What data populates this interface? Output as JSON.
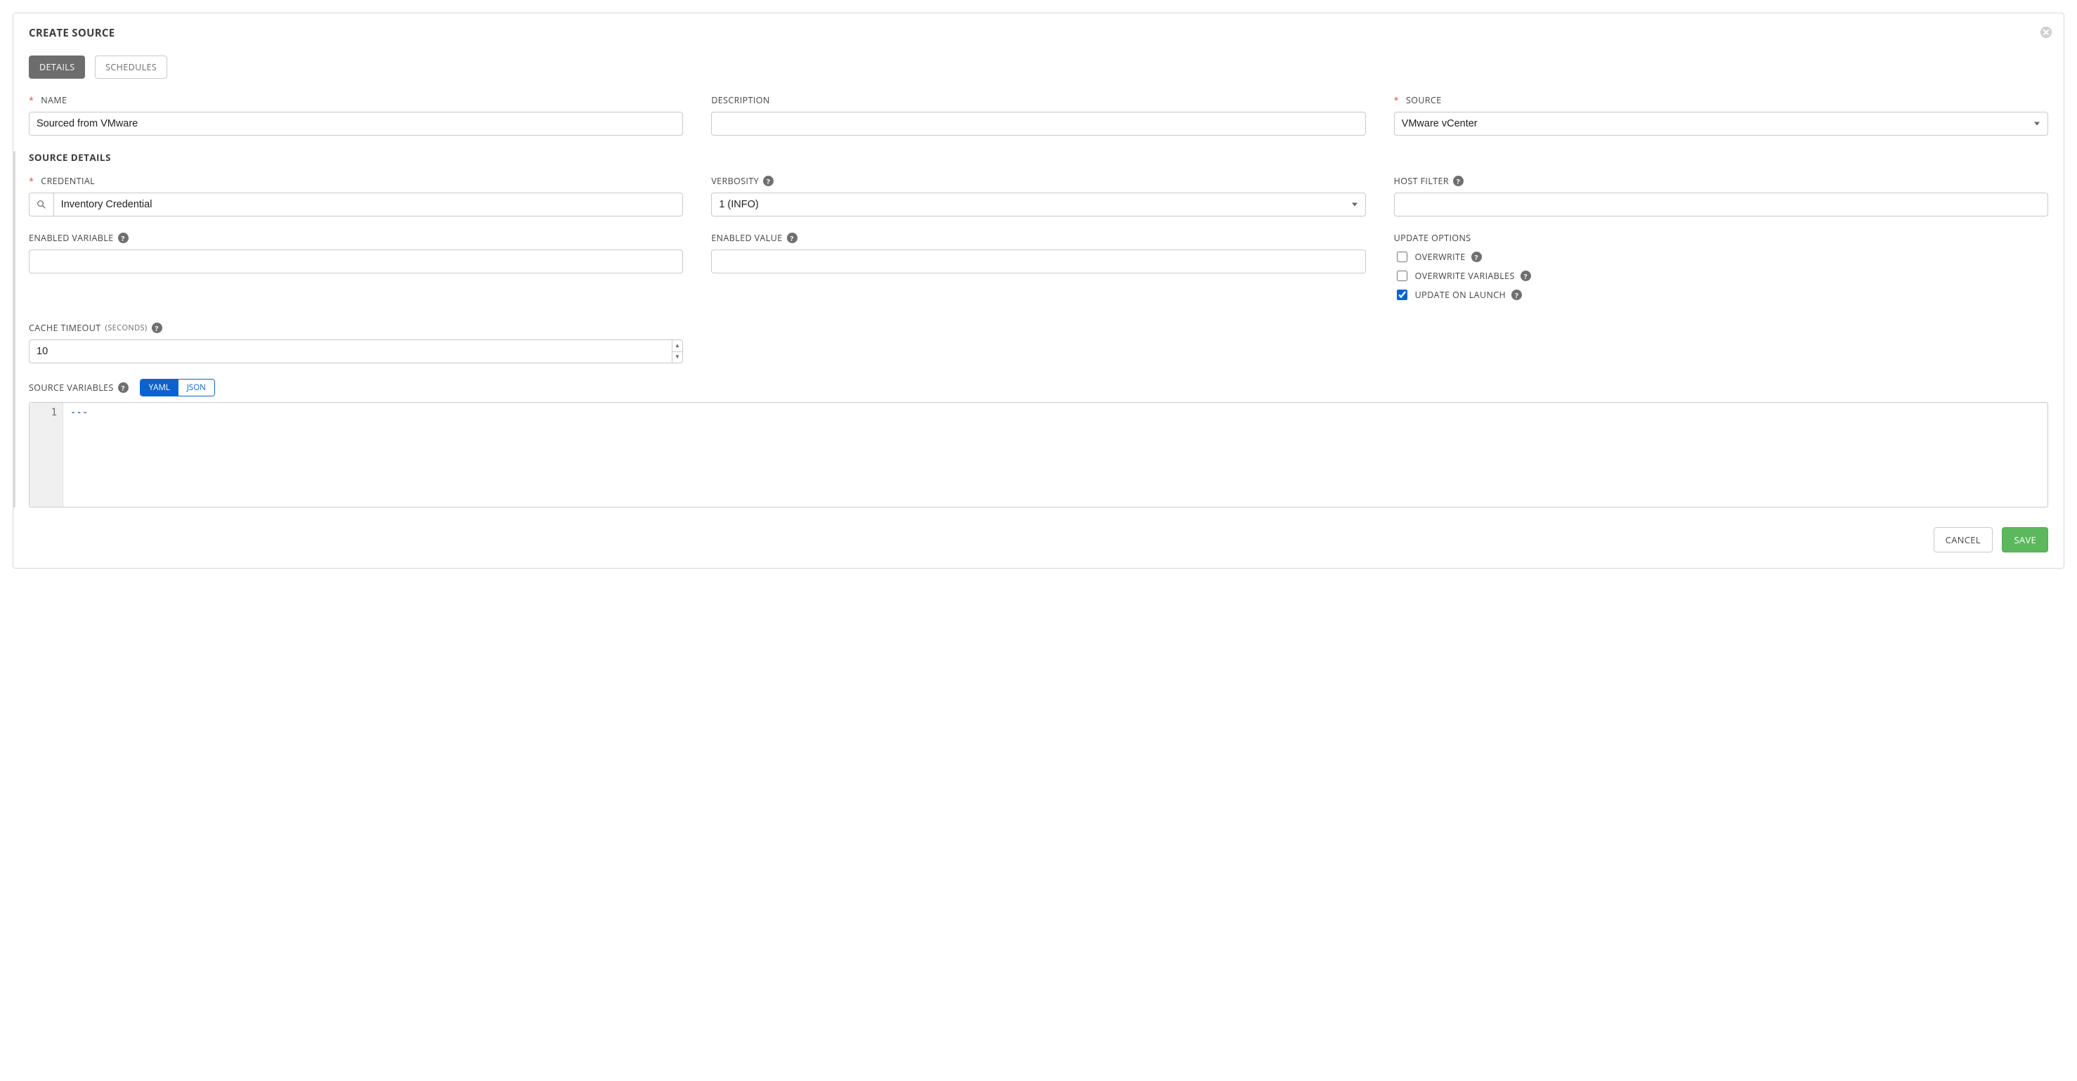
{
  "panel": {
    "title": "CREATE SOURCE"
  },
  "tabs": {
    "details": "DETAILS",
    "schedules": "SCHEDULES"
  },
  "row1": {
    "name_label": "NAME",
    "name_value": "Sourced from VMware",
    "description_label": "DESCRIPTION",
    "description_value": "",
    "source_label": "SOURCE",
    "source_value": "VMware vCenter"
  },
  "section": {
    "title": "SOURCE DETAILS"
  },
  "row2": {
    "credential_label": "CREDENTIAL",
    "credential_value": "Inventory Credential",
    "verbosity_label": "VERBOSITY",
    "verbosity_value": "1 (INFO)",
    "hostfilter_label": "HOST FILTER",
    "hostfilter_value": ""
  },
  "row3": {
    "enabled_var_label": "ENABLED VARIABLE",
    "enabled_var_value": "",
    "enabled_val_label": "ENABLED VALUE",
    "enabled_val_value": "",
    "update_options_label": "UPDATE OPTIONS",
    "overwrite": "OVERWRITE",
    "overwrite_vars": "OVERWRITE VARIABLES",
    "update_on_launch": "UPDATE ON LAUNCH"
  },
  "cache": {
    "label_main": "CACHE TIMEOUT",
    "label_sub": "(SECONDS)",
    "value": "10"
  },
  "sourcevars": {
    "label": "SOURCE VARIABLES",
    "yaml": "YAML",
    "json": "JSON",
    "line_no": "1",
    "content": "---"
  },
  "footer": {
    "cancel": "CANCEL",
    "save": "SAVE"
  }
}
